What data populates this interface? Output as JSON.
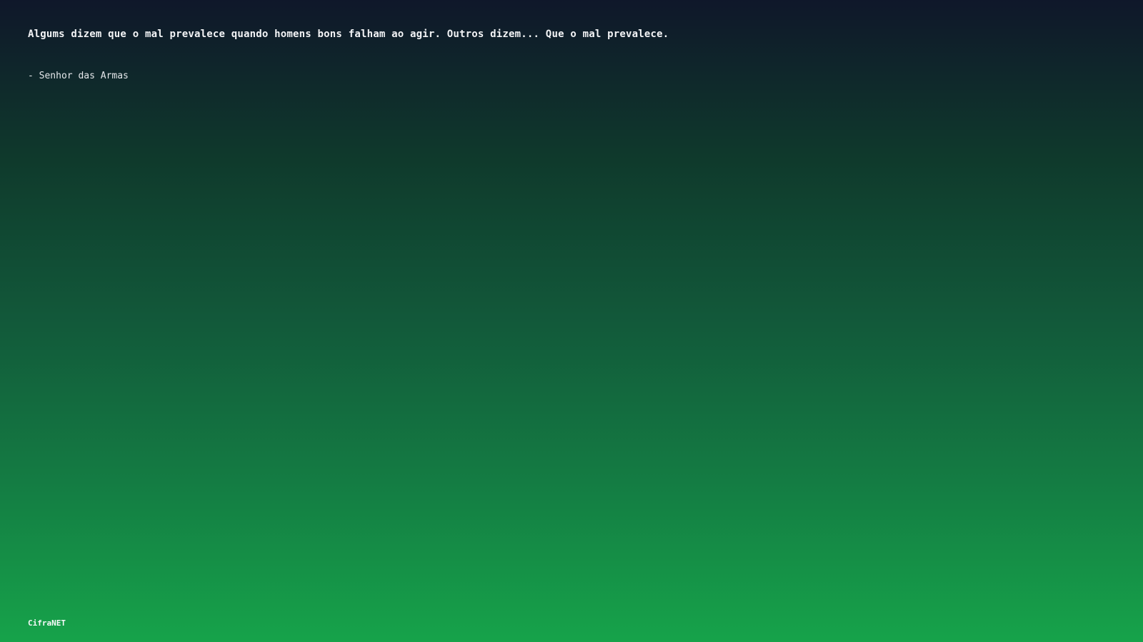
{
  "quote": {
    "text": "Algums dizem que o mal prevalece quando homens bons falham ao agir. Outros dizem... Que o mal prevalece.",
    "author": "- Senhor das Armas"
  },
  "footer": {
    "brand": "CifraNET"
  },
  "colors": {
    "gradient_top": "#0f172a",
    "gradient_bottom": "#16a34a",
    "text": "#f3f4f6"
  }
}
